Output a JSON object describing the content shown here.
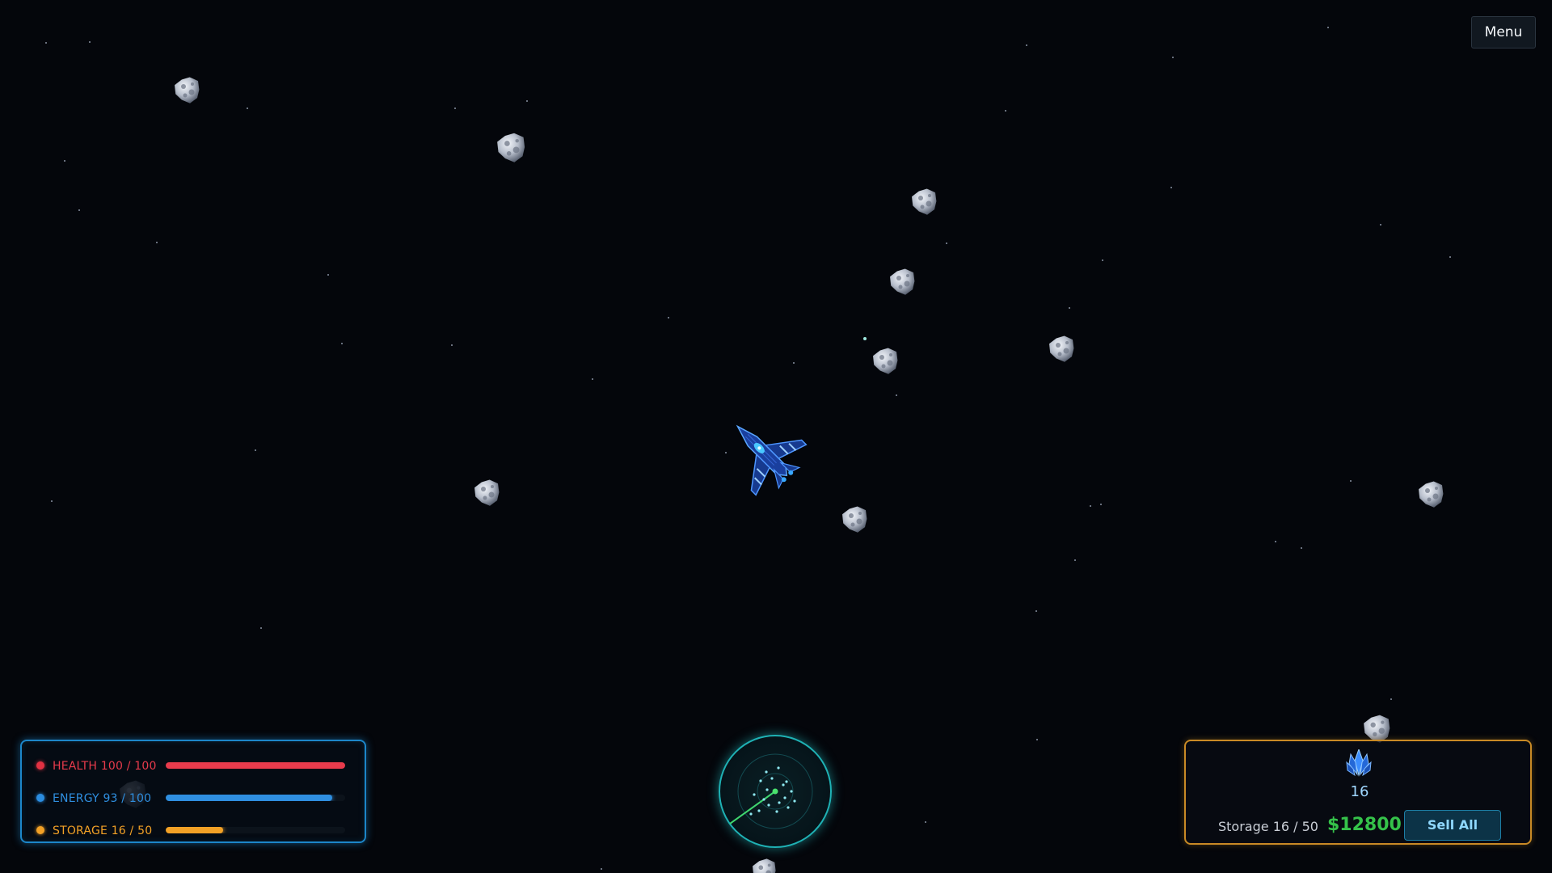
{
  "hud": {
    "menu_label": "Menu",
    "status": [
      {
        "label": "HEALTH 100 / 100",
        "value": 100,
        "max": 100,
        "color": "#e83b4c",
        "dot": "#e23142"
      },
      {
        "label": "ENERGY 93 / 100",
        "value": 93,
        "max": 100,
        "color": "#2f8fe0",
        "dot": "#2b8de0"
      },
      {
        "label": "STORAGE 16 / 50",
        "value": 16,
        "max": 50,
        "color": "#f2a126",
        "dot": "#f2a126"
      }
    ],
    "cargo": {
      "icon": "crystal-icon",
      "crystal_count": "16",
      "storage_text": "Storage 16 / 50",
      "money": "$12800",
      "sell_label": "Sell All"
    }
  },
  "scene": {
    "asteroid_count_visible": 14,
    "player_ship": "blue-fighter-ship"
  }
}
